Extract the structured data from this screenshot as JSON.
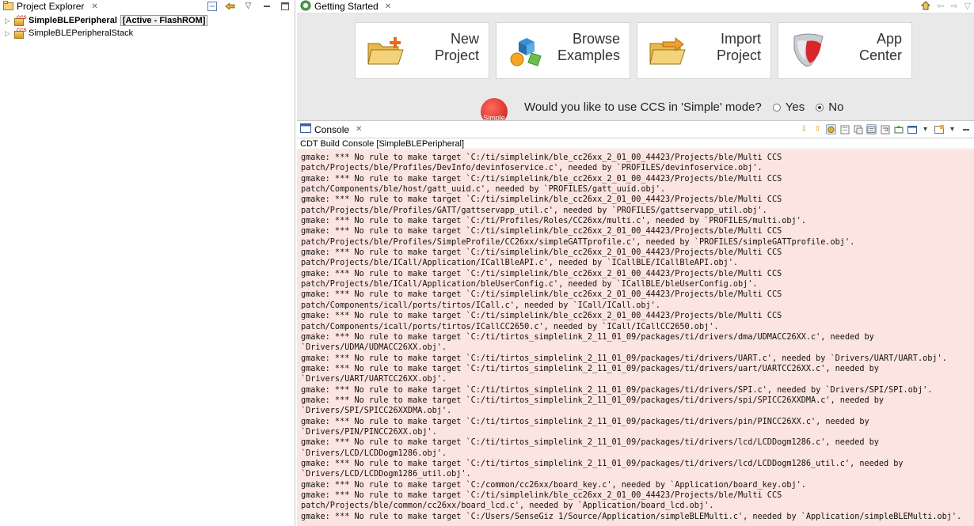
{
  "project_explorer": {
    "tab_label": "Project Explorer",
    "items": [
      {
        "name": "SimpleBLEPeripheral",
        "status": "[Active - FlashROM]"
      },
      {
        "name": "SimpleBLEPeripheralStack",
        "status": ""
      }
    ]
  },
  "getting_started": {
    "tab_label": "Getting Started",
    "tiles": [
      {
        "line1": "New",
        "line2": "Project"
      },
      {
        "line1": "Browse",
        "line2": "Examples"
      },
      {
        "line1": "Import",
        "line2": "Project"
      },
      {
        "line1": "App",
        "line2": "Center"
      }
    ],
    "simple_badge": "Simple",
    "simple_question": "Would you like to use CCS in 'Simple' mode?",
    "yes_label": "Yes",
    "no_label": "No"
  },
  "console": {
    "tab_label": "Console",
    "title": "CDT Build Console [SimpleBLEPeripheral]",
    "lines": [
      "gmake: *** No rule to make target `C:/ti/simplelink/ble_cc26xx_2_01_00_44423/Projects/ble/Multi CCS",
      "patch/Projects/ble/Profiles/DevInfo/devinfoservice.c', needed by `PROFILES/devinfoservice.obj'.",
      "gmake: *** No rule to make target `C:/ti/simplelink/ble_cc26xx_2_01_00_44423/Projects/ble/Multi CCS",
      "patch/Components/ble/host/gatt_uuid.c', needed by `PROFILES/gatt_uuid.obj'.",
      "gmake: *** No rule to make target `C:/ti/simplelink/ble_cc26xx_2_01_00_44423/Projects/ble/Multi CCS",
      "patch/Projects/ble/Profiles/GATT/gattservapp_util.c', needed by `PROFILES/gattservapp_util.obj'.",
      "gmake: *** No rule to make target `C:/ti/Profiles/Roles/CC26xx/multi.c', needed by `PROFILES/multi.obj'.",
      "gmake: *** No rule to make target `C:/ti/simplelink/ble_cc26xx_2_01_00_44423/Projects/ble/Multi CCS",
      "patch/Projects/ble/Profiles/SimpleProfile/CC26xx/simpleGATTprofile.c', needed by `PROFILES/simpleGATTprofile.obj'.",
      "gmake: *** No rule to make target `C:/ti/simplelink/ble_cc26xx_2_01_00_44423/Projects/ble/Multi CCS",
      "patch/Projects/ble/ICall/Application/ICallBleAPI.c', needed by `ICallBLE/ICallBleAPI.obj'.",
      "gmake: *** No rule to make target `C:/ti/simplelink/ble_cc26xx_2_01_00_44423/Projects/ble/Multi CCS",
      "patch/Projects/ble/ICall/Application/bleUserConfig.c', needed by `ICallBLE/bleUserConfig.obj'.",
      "gmake: *** No rule to make target `C:/ti/simplelink/ble_cc26xx_2_01_00_44423/Projects/ble/Multi CCS",
      "patch/Components/icall/ports/tirtos/ICall.c', needed by `ICall/ICall.obj'.",
      "gmake: *** No rule to make target `C:/ti/simplelink/ble_cc26xx_2_01_00_44423/Projects/ble/Multi CCS",
      "patch/Components/icall/ports/tirtos/ICallCC2650.c', needed by `ICall/ICallCC2650.obj'.",
      "gmake: *** No rule to make target `C:/ti/tirtos_simplelink_2_11_01_09/packages/ti/drivers/dma/UDMACC26XX.c', needed by",
      "`Drivers/UDMA/UDMACC26XX.obj'.",
      "gmake: *** No rule to make target `C:/ti/tirtos_simplelink_2_11_01_09/packages/ti/drivers/UART.c', needed by `Drivers/UART/UART.obj'.",
      "gmake: *** No rule to make target `C:/ti/tirtos_simplelink_2_11_01_09/packages/ti/drivers/uart/UARTCC26XX.c', needed by",
      "`Drivers/UART/UARTCC26XX.obj'.",
      "gmake: *** No rule to make target `C:/ti/tirtos_simplelink_2_11_01_09/packages/ti/drivers/SPI.c', needed by `Drivers/SPI/SPI.obj'.",
      "gmake: *** No rule to make target `C:/ti/tirtos_simplelink_2_11_01_09/packages/ti/drivers/spi/SPICC26XXDMA.c', needed by",
      "`Drivers/SPI/SPICC26XXDMA.obj'.",
      "gmake: *** No rule to make target `C:/ti/tirtos_simplelink_2_11_01_09/packages/ti/drivers/pin/PINCC26XX.c', needed by",
      "`Drivers/PIN/PINCC26XX.obj'.",
      "gmake: *** No rule to make target `C:/ti/tirtos_simplelink_2_11_01_09/packages/ti/drivers/lcd/LCDDogm1286.c', needed by",
      "`Drivers/LCD/LCDDogm1286.obj'.",
      "gmake: *** No rule to make target `C:/ti/tirtos_simplelink_2_11_01_09/packages/ti/drivers/lcd/LCDDogm1286_util.c', needed by",
      "`Drivers/LCD/LCDDogm1286_util.obj'.",
      "gmake: *** No rule to make target `C:/common/cc26xx/board_key.c', needed by `Application/board_key.obj'.",
      "gmake: *** No rule to make target `C:/ti/simplelink/ble_cc26xx_2_01_00_44423/Projects/ble/Multi CCS",
      "patch/Projects/ble/common/cc26xx/board_lcd.c', needed by `Application/board_lcd.obj'.",
      "gmake: *** No rule to make target `C:/Users/SenseGiz 1/Source/Application/simpleBLEMulti.c', needed by `Application/simpleBLEMulti.obj'."
    ]
  }
}
